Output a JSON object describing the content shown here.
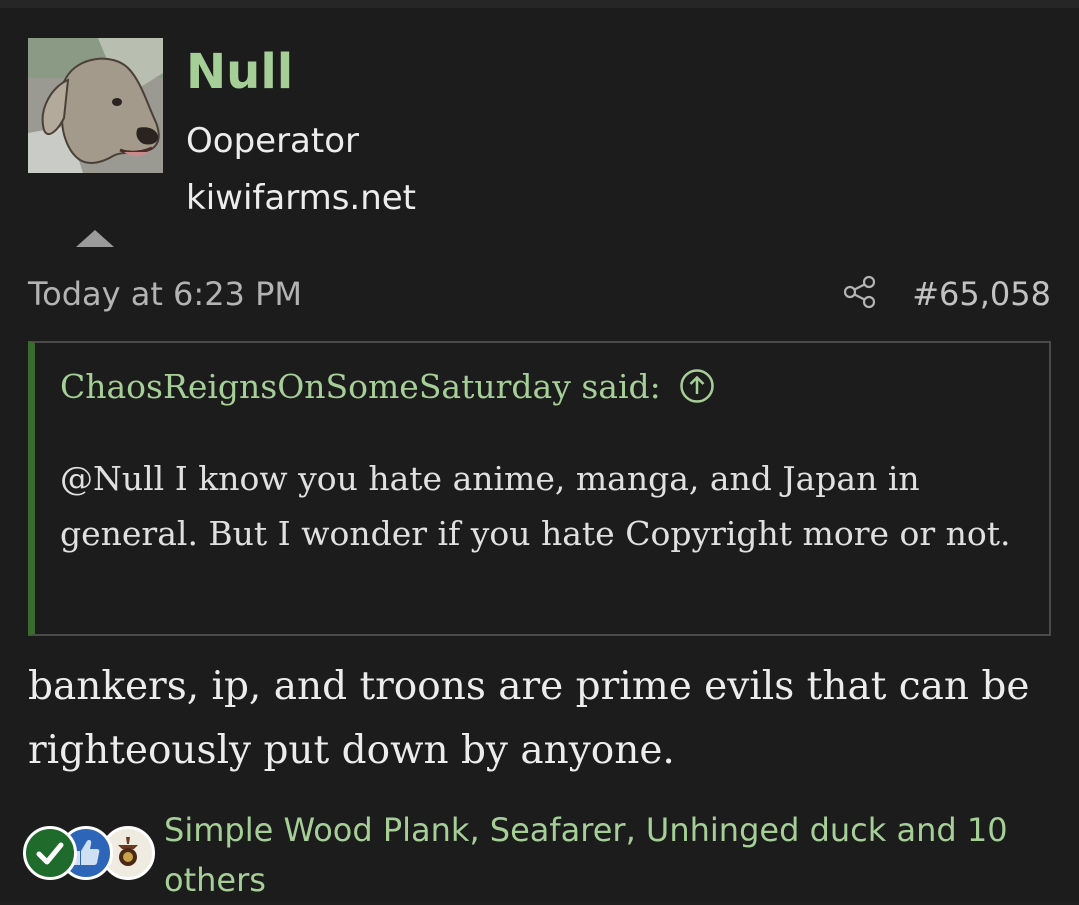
{
  "author": {
    "name": "Null",
    "title": "Ooperator",
    "site": "kiwifarms.net",
    "avatar": "dog-avatar"
  },
  "meta": {
    "timestamp": "Today at 6:23 PM",
    "share_icon": "share-icon",
    "post_number": "#65,058"
  },
  "quote": {
    "author_label": "ChaosReignsOnSomeSaturday said:",
    "jump_icon": "arrow-up-circle-icon",
    "text": "@Null I know you hate anime, manga, and Japan in general. But I wonder if you hate Copyright more or not."
  },
  "body": {
    "text": "bankers, ip, and troons are prime evils that can be righteously put down by anyone."
  },
  "reactions": {
    "icons": [
      "checkmark-reaction-icon",
      "thumbs-up-reaction-icon",
      "seal-reaction-icon"
    ],
    "text": "Simple Wood Plank, Seafarer, Unhinged duck and 10 others"
  },
  "colors": {
    "background": "#1c1c1c",
    "accent_green": "#a6cf98",
    "quote_border": "#3b6b2c"
  }
}
